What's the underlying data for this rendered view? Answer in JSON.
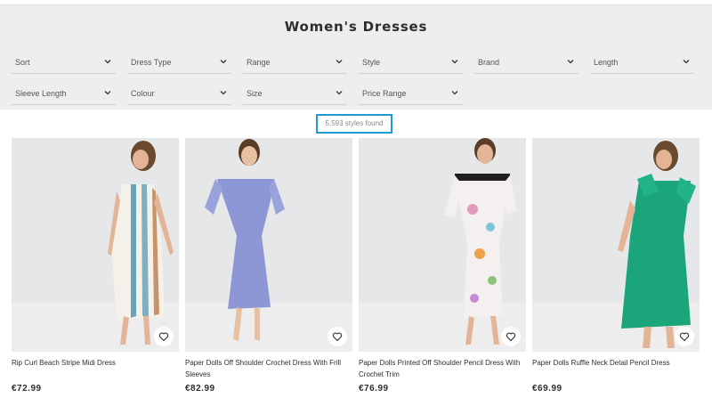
{
  "header": {
    "title": "Women's Dresses"
  },
  "filters": [
    {
      "label": "Sort"
    },
    {
      "label": "Dress Type"
    },
    {
      "label": "Range"
    },
    {
      "label": "Style"
    },
    {
      "label": "Brand"
    },
    {
      "label": "Length"
    },
    {
      "label": "Sleeve Length"
    },
    {
      "label": "Colour"
    },
    {
      "label": "Size"
    },
    {
      "label": "Price Range"
    }
  ],
  "results": {
    "count_text": "5,593 styles found",
    "highlight_color": "#1e9bd7"
  },
  "products": [
    {
      "name": "Rip Curl Beach Stripe Midi Dress",
      "price": "€72.99",
      "icon": "heart-icon"
    },
    {
      "name": "Paper Dolls Off Shoulder Crochet Dress With Frill Sleeves",
      "price": "€82.99",
      "icon": "heart-icon"
    },
    {
      "name": "Paper Dolls Printed Off Shoulder Pencil Dress With Crochet Trim",
      "price": "€76.99",
      "icon": "heart-icon"
    },
    {
      "name": "Paper Dolls Ruffle Neck Detail Pencil Dress",
      "price": "€69.99",
      "icon": "heart-icon"
    }
  ]
}
